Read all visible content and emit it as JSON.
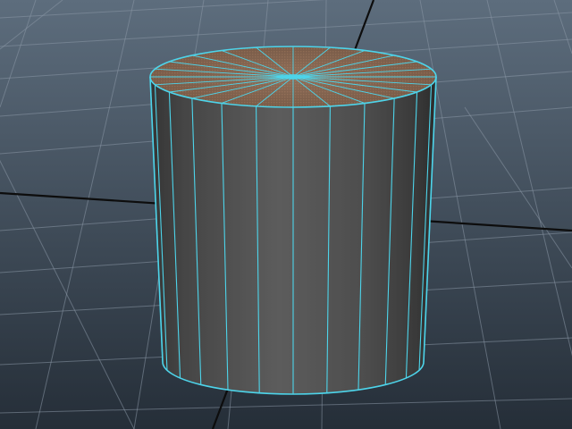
{
  "viewport": {
    "background_top": "#5d6d7d",
    "background_bottom": "#252e38",
    "grid_color": "#8a98a6",
    "axis_color": "#0d0d0d"
  },
  "selected_object": {
    "type": "polygon-cylinder",
    "selected": true,
    "side_faces_shown": 24,
    "cap_segments": 24,
    "wireframe_color": "#4dd4ea",
    "side_color": "#565656",
    "cap_color": "#8a6a55"
  }
}
